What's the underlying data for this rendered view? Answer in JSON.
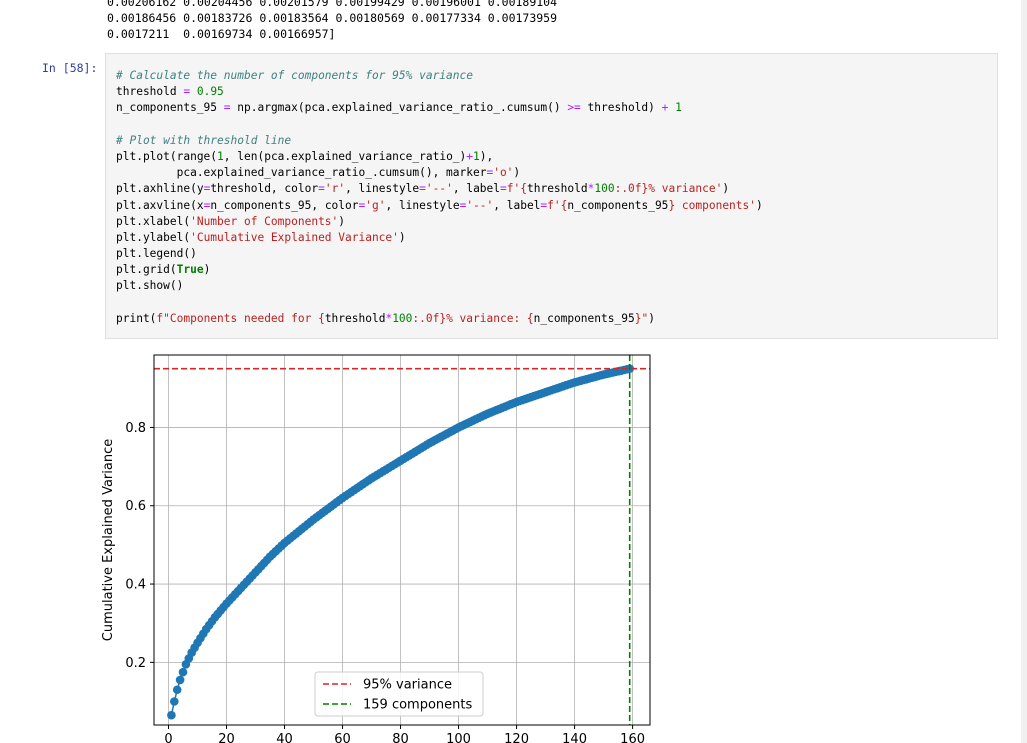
{
  "output_prev": {
    "lines": [
      "0.00206162 0.00204456 0.00201579 0.00199429 0.00196001 0.00189104",
      "0.00186456 0.00183726 0.00183564 0.00180569 0.00177334 0.00173959",
      "0.0017211  0.00169734 0.00166957]"
    ]
  },
  "cell": {
    "prompt": "In [58]:",
    "code": {
      "l1": "# Calculate the number of components for 95% variance",
      "l2a": "threshold ",
      "l2b": "=",
      "l2c": " 0.95",
      "l3a": "n_components_95 ",
      "l3b": "=",
      "l3c": " np.argmax(pca.explained_variance_ratio_.cumsum() ",
      "l3d": ">=",
      "l3e": " threshold) ",
      "l3f": "+",
      "l3g": " 1",
      "l5": "# Plot with threshold line",
      "l6a": "plt.plot(range(",
      "l6b": "1",
      "l6c": ", len(pca.explained_variance_ratio_)",
      "l6d": "+",
      "l6e": "1",
      "l6f": "),",
      "l7a": "         pca.explained_variance_ratio_.cumsum(), marker",
      "l7b": "=",
      "l7c": "'o'",
      "l7d": ")",
      "l8a": "plt.axhline(y",
      "l8b": "=",
      "l8c": "threshold, color",
      "l8d": "=",
      "l8e": "'r'",
      "l8f": ", linestyle",
      "l8g": "=",
      "l8h": "'--'",
      "l8i": ", label",
      "l8j": "=",
      "l8k": "f'{",
      "l8l": "threshold",
      "l8m": "*",
      "l8n": "100",
      "l8o": ":.0f}% variance'",
      "l8p": ")",
      "l9a": "plt.axvline(x",
      "l9b": "=",
      "l9c": "n_components_95, color",
      "l9d": "=",
      "l9e": "'g'",
      "l9f": ", linestyle",
      "l9g": "=",
      "l9h": "'--'",
      "l9i": ", label",
      "l9j": "=",
      "l9k": "f'{",
      "l9l": "n_components_95",
      "l9m": "} components'",
      "l9n": ")",
      "l10a": "plt.xlabel(",
      "l10b": "'Number of Components'",
      "l10c": ")",
      "l11a": "plt.ylabel(",
      "l11b": "'Cumulative Explained Variance'",
      "l11c": ")",
      "l12": "plt.legend()",
      "l13a": "plt.grid(",
      "l13b": "True",
      "l13c": ")",
      "l14": "plt.show()",
      "l16a": "print(",
      "l16b": "f\"Components needed for {",
      "l16c": "threshold",
      "l16d": "*",
      "l16e": "100",
      "l16f": ":.0f}% variance: {",
      "l16g": "n_components_95",
      "l16h": "}\"",
      "l16i": ")"
    }
  },
  "chart_data": {
    "type": "line",
    "marker": "o",
    "ylabel": "Cumulative Explained Variance",
    "xlim": [
      -5,
      166
    ],
    "ylim": [
      0.04,
      0.985
    ],
    "xticks": [
      0,
      20,
      40,
      60,
      80,
      100,
      120,
      140,
      160
    ],
    "yticks": [
      0.2,
      0.4,
      0.6,
      0.8
    ],
    "ytick_labels": [
      "0.2",
      "0.4",
      "0.6",
      "0.8"
    ],
    "grid": true,
    "n_points": 159,
    "anchors": [
      [
        1,
        0.065
      ],
      [
        2,
        0.1
      ],
      [
        3,
        0.13
      ],
      [
        4,
        0.155
      ],
      [
        5,
        0.175
      ],
      [
        6,
        0.195
      ],
      [
        8,
        0.225
      ],
      [
        10,
        0.25
      ],
      [
        13,
        0.285
      ],
      [
        16,
        0.315
      ],
      [
        20,
        0.35
      ],
      [
        25,
        0.39
      ],
      [
        30,
        0.43
      ],
      [
        35,
        0.47
      ],
      [
        40,
        0.505
      ],
      [
        50,
        0.565
      ],
      [
        60,
        0.62
      ],
      [
        70,
        0.67
      ],
      [
        80,
        0.715
      ],
      [
        90,
        0.76
      ],
      [
        100,
        0.8
      ],
      [
        110,
        0.835
      ],
      [
        120,
        0.865
      ],
      [
        130,
        0.89
      ],
      [
        140,
        0.915
      ],
      [
        150,
        0.935
      ],
      [
        159,
        0.95
      ]
    ],
    "series_color": "#1f77b4",
    "threshold": {
      "y": 0.95,
      "color": "#d62728",
      "label": "95% variance"
    },
    "components": {
      "x": 159,
      "color": "#008000",
      "label": "159 components"
    },
    "legend_position": "lower-center"
  }
}
